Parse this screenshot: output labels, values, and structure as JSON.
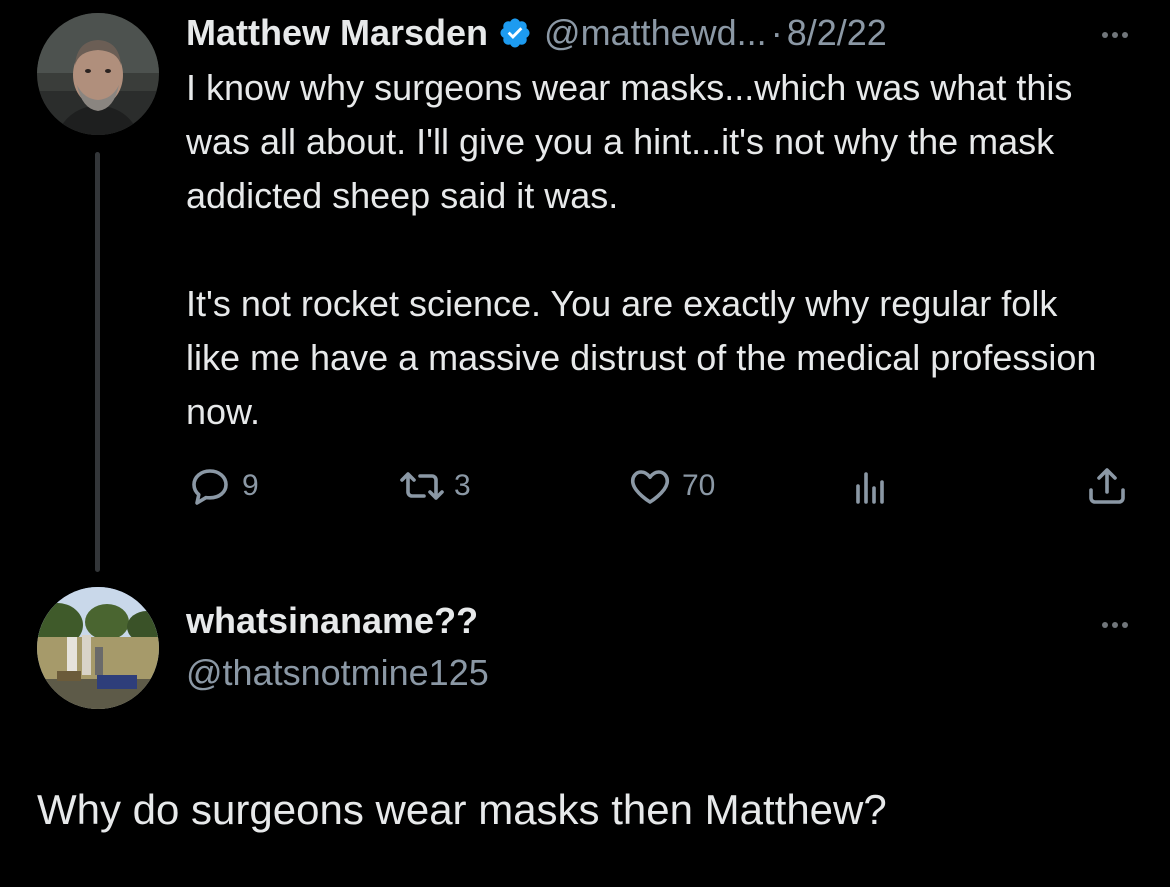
{
  "tweet": {
    "author": {
      "name": "Matthew Marsden",
      "handle": "@matthewd...",
      "verified": true
    },
    "separator": "·",
    "date": "8/2/22",
    "paragraphs": [
      "I know why surgeons wear masks...which was what this was all about. I'll give you a hint...it's not why the mask addicted sheep said it was.",
      "It's not rocket science. You are exactly why regular folk like me have a massive distrust of the medical profession now."
    ],
    "actions": {
      "replies": "9",
      "retweets": "3",
      "likes": "70"
    },
    "icons": [
      "reply-icon",
      "retweet-icon",
      "heart-icon",
      "views-icon",
      "share-icon",
      "more-icon",
      "verified-badge-icon"
    ]
  },
  "reply": {
    "author": {
      "name": "whatsinaname??",
      "handle": "@thatsnotmine125"
    },
    "text": "Why do surgeons wear masks then Matthew?"
  },
  "colors": {
    "background": "#000000",
    "text": "#e7e9ea",
    "secondary": "#8b98a5",
    "verified": "#1d9bf0",
    "thread_line": "#333639"
  }
}
